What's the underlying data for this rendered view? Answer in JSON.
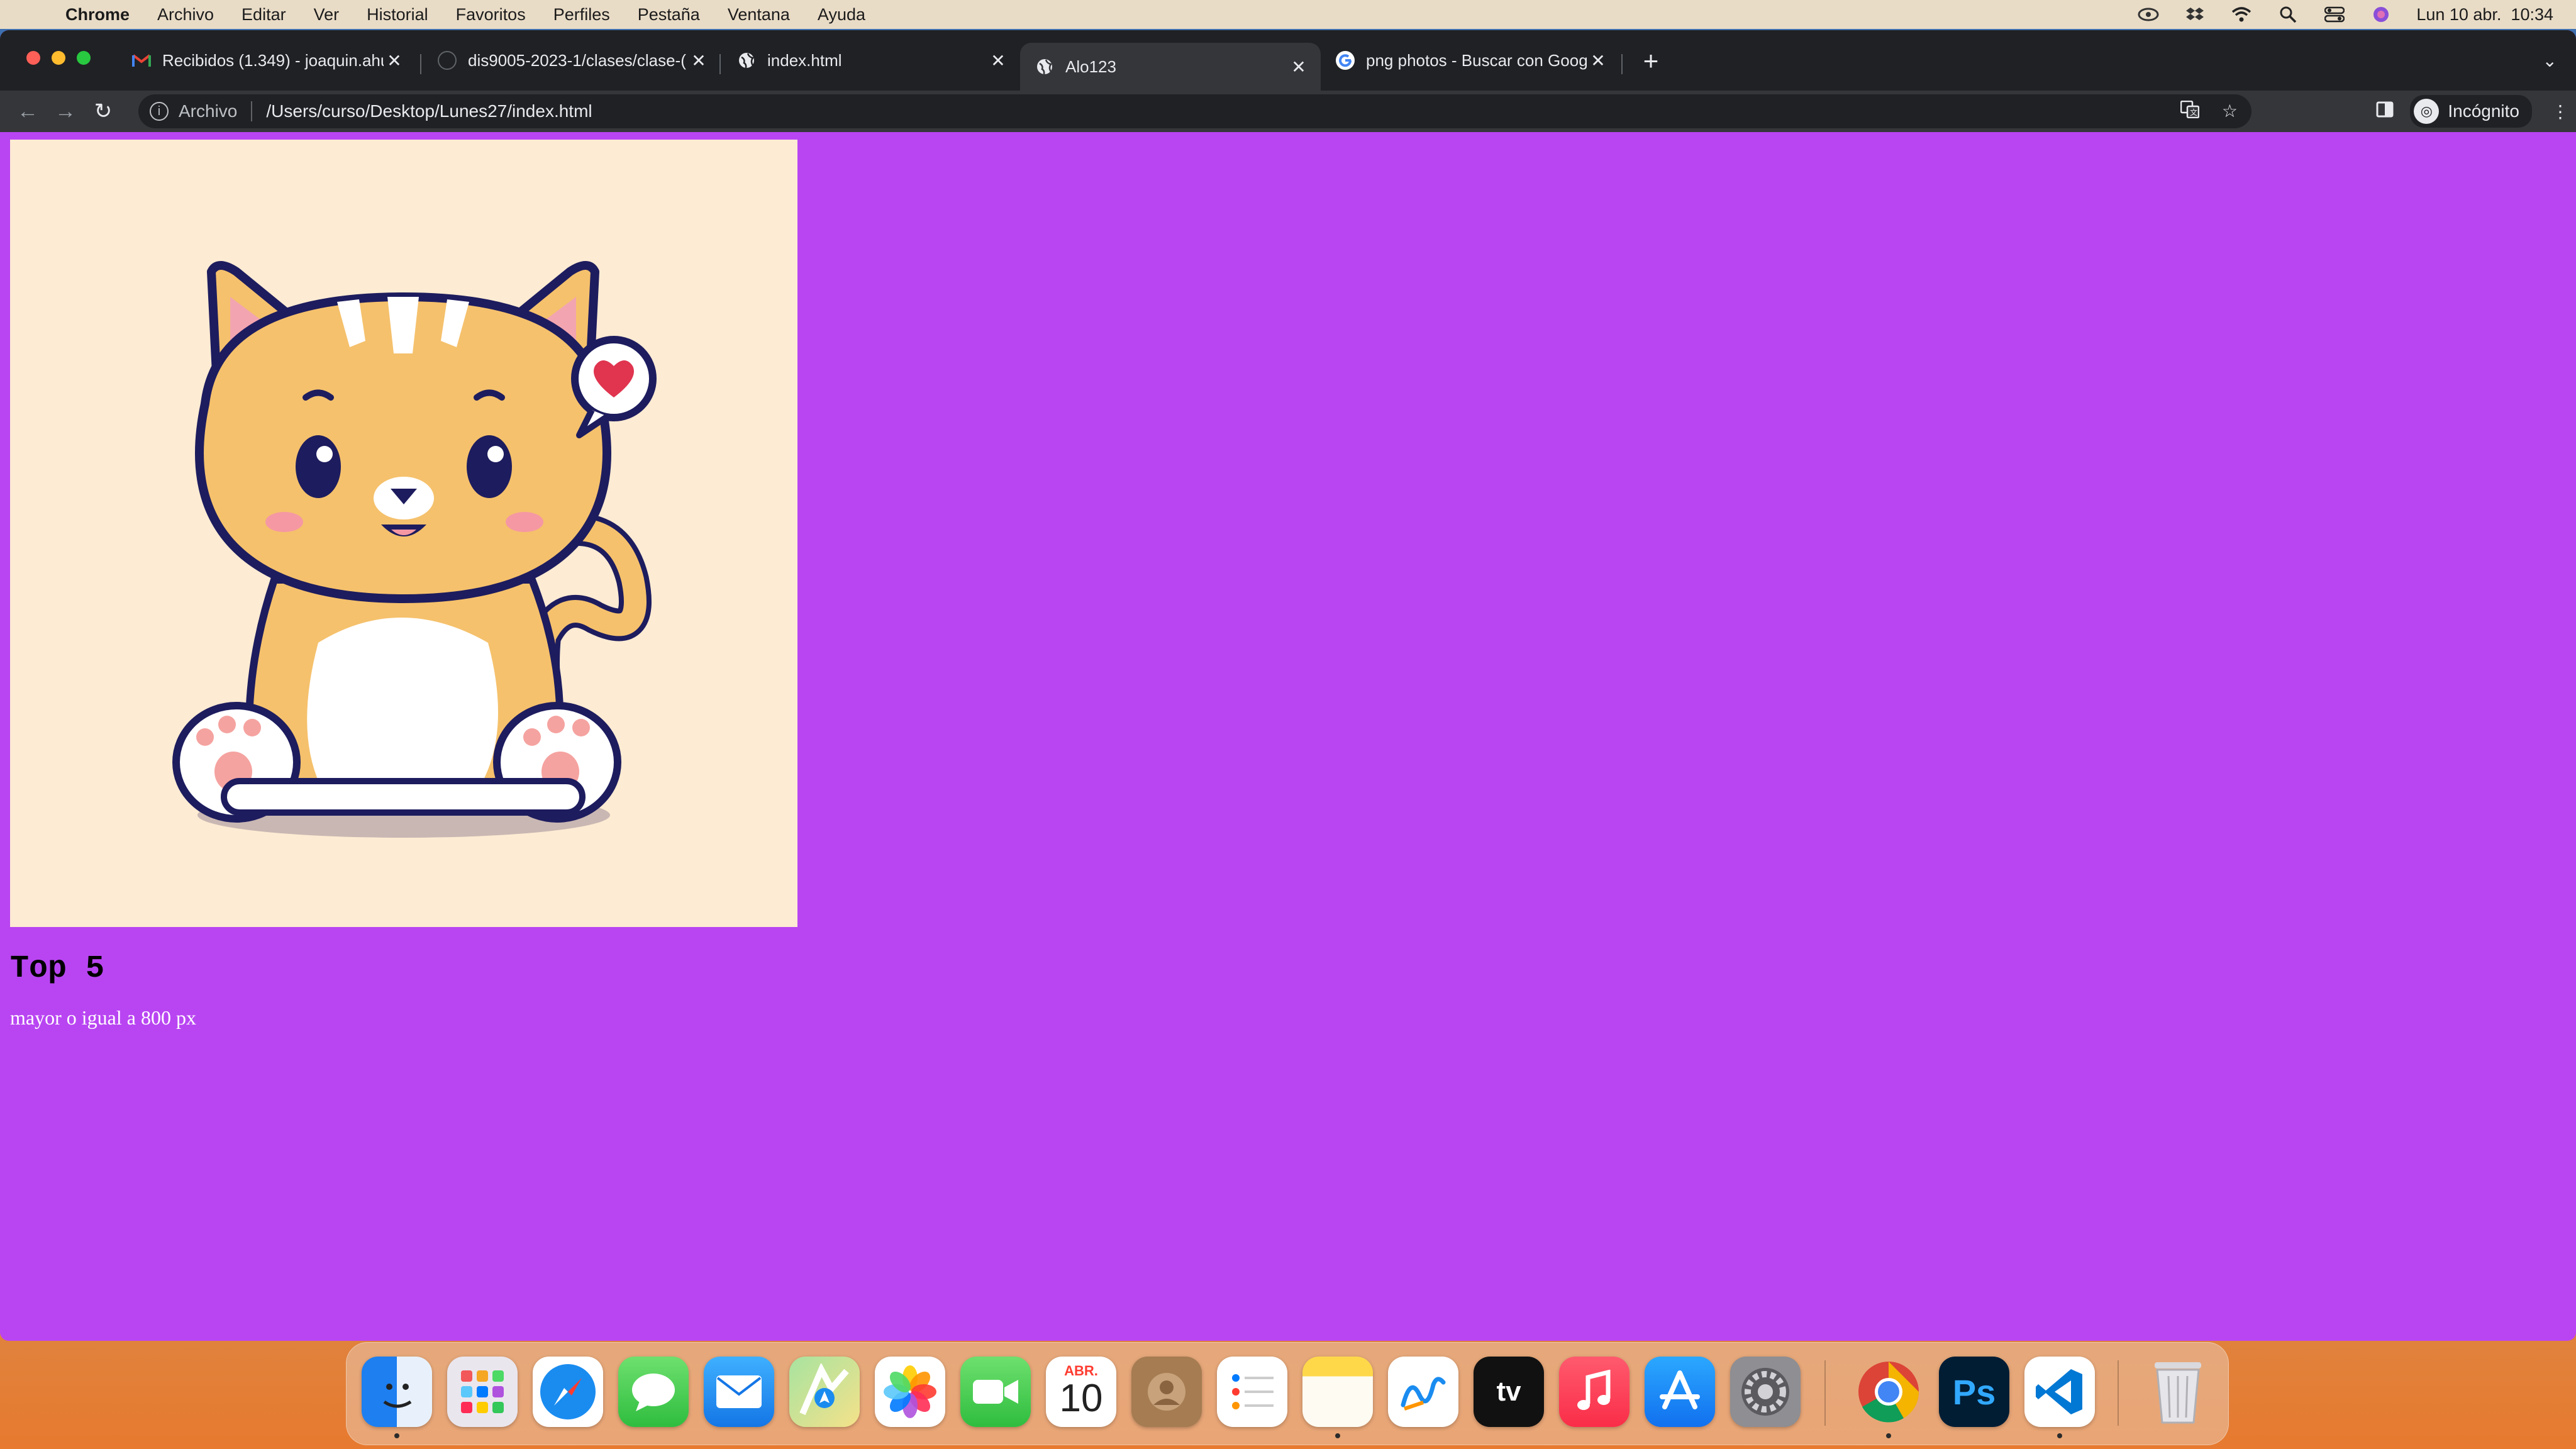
{
  "menubar": {
    "app_name": "Chrome",
    "items": [
      "Archivo",
      "Editar",
      "Ver",
      "Historial",
      "Favoritos",
      "Perfiles",
      "Pestaña",
      "Ventana",
      "Ayuda"
    ],
    "clock": "Lun 10 abr.  10:34"
  },
  "tabs": [
    {
      "title": "Recibidos (1.349) - joaquin.ahu",
      "icon": "gmail-icon"
    },
    {
      "title": "dis9005-2023-1/clases/clase-(",
      "icon": "github-icon"
    },
    {
      "title": "index.html",
      "icon": "globe-icon"
    },
    {
      "title": "Alo123",
      "icon": "globe-icon",
      "active": true
    },
    {
      "title": "png photos - Buscar con Google",
      "icon": "google-icon"
    }
  ],
  "toolbar": {
    "scheme_label": "Archivo",
    "url": "/Users/curso/Desktop/Lunes27/index.html",
    "profile_label": "Incógnito"
  },
  "page": {
    "heading": "Top 5",
    "paragraph": "mayor o igual a 800 px",
    "background_color": "#b945f2"
  },
  "dock": {
    "calendar_month": "ABR.",
    "calendar_day": "10",
    "photoshop_label": "Ps",
    "appletv_label": "tv"
  }
}
